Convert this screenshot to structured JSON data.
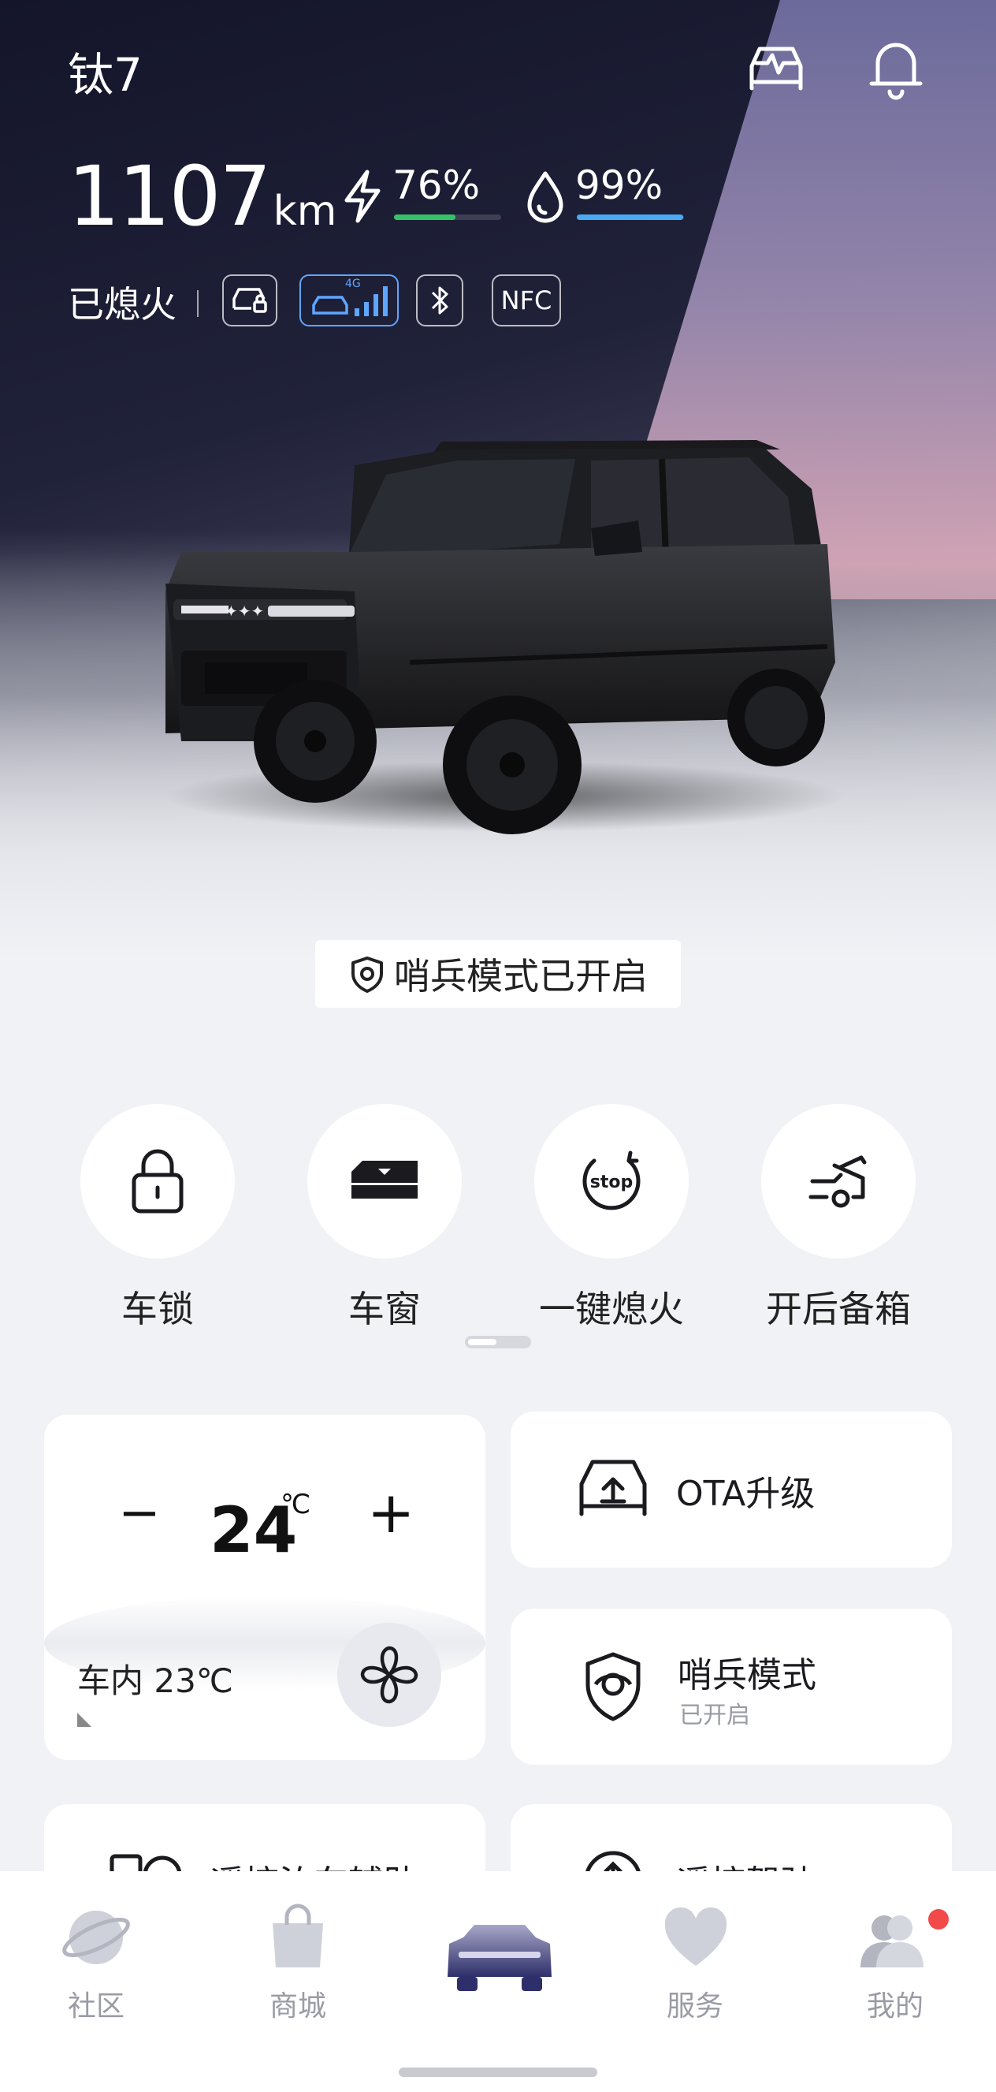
{
  "vehicle": {
    "name": "钛7",
    "range_value": "1107",
    "range_unit": "km",
    "battery_percent": "76%",
    "battery_level": 0.76,
    "fuel_percent": "99%",
    "fuel_level": 0.99,
    "status": "已熄火",
    "chips": {
      "network_badge": "4G",
      "nfc": "NFC"
    }
  },
  "sentinel_banner": "哨兵模式已开启",
  "quick_actions": [
    {
      "label": "车锁",
      "icon": "lock-icon"
    },
    {
      "label": "车窗",
      "icon": "window-icon"
    },
    {
      "label": "一键熄火",
      "icon": "stop-engine-icon",
      "icon_text": "stop"
    },
    {
      "label": "开后备箱",
      "icon": "trunk-icon"
    }
  ],
  "climate": {
    "minus": "−",
    "plus": "+",
    "temperature": "24",
    "unit": "℃",
    "interior_label": "车内 23℃"
  },
  "services": [
    {
      "title": "OTA升级",
      "icon": "ota-upgrade-icon"
    },
    {
      "title": "哨兵模式",
      "subtitle": "已开启",
      "icon": "sentinel-icon"
    },
    {
      "title": "遥控泊车辅助",
      "icon": "remote-parking-icon"
    },
    {
      "title": "遥控驾驶",
      "icon": "remote-drive-icon"
    }
  ],
  "tabbar": [
    {
      "label": "社区",
      "icon": "planet-icon"
    },
    {
      "label": "商城",
      "icon": "shopping-bag-icon"
    },
    {
      "label": "",
      "icon": "car-icon"
    },
    {
      "label": "服务",
      "icon": "heart-icon"
    },
    {
      "label": "我的",
      "icon": "profile-icon"
    }
  ],
  "colors": {
    "battery_bar": "#35c266",
    "fuel_bar": "#4aa9f5",
    "notification_dot": "#f04a4a",
    "tab_active": "#2e2f6a"
  }
}
